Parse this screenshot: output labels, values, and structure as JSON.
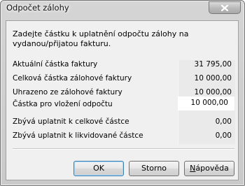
{
  "window": {
    "title": "Odpočet zálohy"
  },
  "intro_text": "Zadejte částku k uplatnění odpočtu zálohy na vydanou/přijatou fakturu.",
  "rows": [
    {
      "label": "Aktuální částka faktury",
      "value": "31 795,00"
    },
    {
      "label": "Celková částka zálohové faktury",
      "value": "10 000,00"
    },
    {
      "label": "Uhrazeno ze zálohové faktury",
      "value": "10 000,00"
    },
    {
      "label": "Částka pro vložení odpočtu",
      "value": "10 000,00"
    },
    {
      "label": "Zbývá uplatnit k celkové částce",
      "value": "0,00"
    },
    {
      "label": "Zbývá uplatnit k likvidované částce",
      "value": "0,00"
    }
  ],
  "buttons": {
    "ok": "OK",
    "storno": "Storno",
    "help_first": "N",
    "help_rest": "ápověda"
  },
  "icons": {
    "close": "close-icon"
  }
}
